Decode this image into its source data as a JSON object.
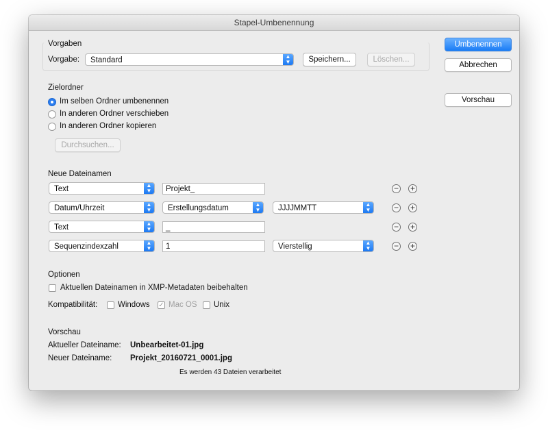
{
  "window": {
    "title": "Stapel-Umbenennung"
  },
  "side_buttons": {
    "rename": "Umbenennen",
    "cancel": "Abbrechen",
    "preview": "Vorschau"
  },
  "presets": {
    "title": "Vorgaben",
    "label": "Vorgabe:",
    "selected": "Standard",
    "save": "Speichern...",
    "delete": "Löschen..."
  },
  "destination": {
    "title": "Zielordner",
    "options": [
      "Im selben Ordner umbenennen",
      "In anderen Ordner verschieben",
      "In anderen Ordner kopieren"
    ],
    "selected_index": 0,
    "browse": "Durchsuchen..."
  },
  "new_names": {
    "title": "Neue Dateinamen",
    "rows": [
      {
        "type": "Text",
        "value": "Projekt_"
      },
      {
        "type": "Datum/Uhrzeit",
        "sub": "Erstellungsdatum",
        "format": "JJJJMMTT"
      },
      {
        "type": "Text",
        "value": "_"
      },
      {
        "type": "Sequenzindexzahl",
        "value": "1",
        "format": "Vierstellig"
      }
    ],
    "minus": "−",
    "plus": "+"
  },
  "options": {
    "title": "Optionen",
    "keep_xmp": "Aktuellen Dateinamen in XMP-Metadaten beibehalten",
    "compat_label": "Kompatibilität:",
    "windows": "Windows",
    "macos": "Mac OS",
    "unix": "Unix",
    "check_mark": "✓"
  },
  "preview": {
    "title": "Vorschau",
    "current_label": "Aktueller Dateiname:",
    "current_value": "Unbearbeitet-01.jpg",
    "new_label": "Neuer Dateiname:",
    "new_value": "Projekt_20160721_0001.jpg",
    "count_text": "Es werden 43 Dateien verarbeitet"
  },
  "icons": {
    "chevron": "up-down-chevron-icon"
  }
}
